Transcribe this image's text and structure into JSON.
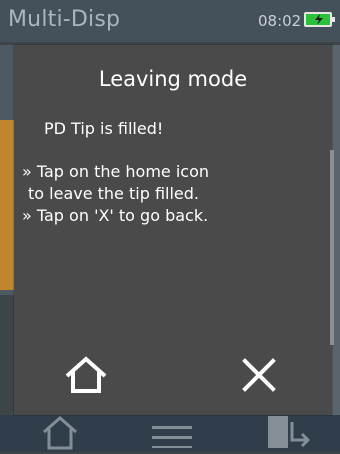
{
  "app": {
    "title": "Multi-Disp",
    "time": "08:02"
  },
  "dialog": {
    "title": "Leaving mode",
    "status": "PD Tip is filled!",
    "instructions": [
      "» Tap on the home icon",
      "to leave the tip filled.",
      "» Tap on 'X' to go back."
    ]
  },
  "icons": {
    "battery": "battery-charging-icon",
    "home": "home-icon",
    "close": "close-icon",
    "nav_home": "home-icon",
    "nav_menu": "menu-icon",
    "nav_tip": "pipette-tip-icon"
  },
  "colors": {
    "dialog_bg": "#4a4a4a",
    "header_bg": "#44505a",
    "accent_orange": "#c1862d",
    "battery_green": "#2ac23a"
  }
}
